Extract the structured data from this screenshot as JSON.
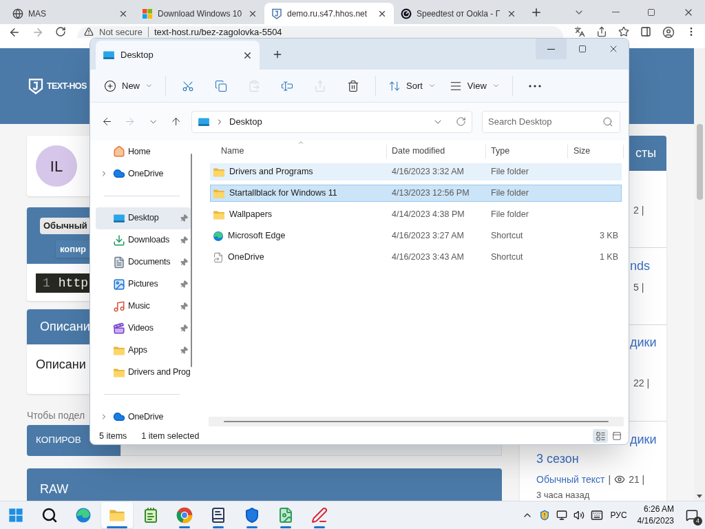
{
  "browser": {
    "tabs": [
      {
        "kind": "globe",
        "title": "MAS",
        "selected": false
      },
      {
        "kind": "squares",
        "title": "Download Windows 10",
        "selected": false
      },
      {
        "kind": "site",
        "title": "demo.ru.s47.hhos.net",
        "selected": true
      },
      {
        "kind": "gauge",
        "title": "Speedtest от Ookla - Г",
        "selected": false
      }
    ],
    "security": "Not secure",
    "url": "text-host.ru/bez-zagolovka-5504"
  },
  "page": {
    "logo": "TEXT-HOS",
    "avatar": "IL",
    "badge": "Обычный",
    "copy_link": "копир",
    "code_line": "1",
    "code_text": "http",
    "description_title": "Описани",
    "description_text": "Описани",
    "share_hint": "Чтобы подел",
    "copy_button": "КОПИРОВ",
    "raw_button": "RAW",
    "sidebar": {
      "title": "сты",
      "items": [
        {
          "meta": "2 |"
        },
        {
          "title": "nds",
          "meta": "5 |"
        },
        {
          "title": "дики",
          "meta": "22 |"
        }
      ],
      "last_item": {
        "title": "дики",
        "subtitle": "3 сезон",
        "category": "Обычный текст",
        "separator": "|",
        "views": "21 |",
        "time": "3 часа назад"
      }
    }
  },
  "explorer": {
    "tab": "Desktop",
    "toolbar": [
      [
        {
          "kind": "new",
          "label": "New",
          "disabled": false
        }
      ],
      [
        {
          "kind": "cut",
          "disabled": false
        },
        {
          "kind": "copy",
          "disabled": false
        },
        {
          "kind": "paste",
          "disabled": true
        },
        {
          "kind": "rename",
          "disabled": false
        },
        {
          "kind": "share",
          "disabled": true
        },
        {
          "kind": "delete",
          "disabled": false
        }
      ],
      [
        {
          "kind": "sort",
          "label": "Sort",
          "disabled": false
        },
        {
          "kind": "view",
          "label": "View",
          "disabled": false
        }
      ],
      [
        {
          "kind": "more",
          "disabled": false
        }
      ]
    ],
    "back_disabled": false,
    "forward_disabled": true,
    "path": "Desktop",
    "search_placeholder": "Search Desktop",
    "nav": [
      {
        "items": [
          {
            "kind": "home",
            "label": "Home",
            "expandable": false,
            "pinned": false,
            "selected": false
          },
          {
            "kind": "cloud",
            "label": "OneDrive",
            "expandable": true,
            "pinned": false,
            "selected": false
          }
        ]
      },
      {
        "items": [
          {
            "kind": "desktop",
            "label": "Desktop",
            "expandable": false,
            "pinned": true,
            "selected": true
          },
          {
            "kind": "download",
            "label": "Downloads",
            "expandable": false,
            "pinned": true,
            "selected": false
          },
          {
            "kind": "document",
            "label": "Documents",
            "expandable": false,
            "pinned": true,
            "selected": false
          },
          {
            "kind": "picture",
            "label": "Pictures",
            "expandable": false,
            "pinned": true,
            "selected": false
          },
          {
            "kind": "music",
            "label": "Music",
            "expandable": false,
            "pinned": true,
            "selected": false
          },
          {
            "kind": "video",
            "label": "Videos",
            "expandable": false,
            "pinned": true,
            "selected": false
          },
          {
            "kind": "apps",
            "label": "Apps",
            "expandable": false,
            "pinned": true,
            "selected": false
          },
          {
            "kind": "folder",
            "label": "Drivers and Prog",
            "expandable": false,
            "pinned": false,
            "selected": false
          }
        ]
      },
      {
        "items": [
          {
            "kind": "cloud",
            "label": "OneDrive",
            "expandable": true,
            "pinned": false,
            "selected": false
          }
        ]
      }
    ],
    "columns": [
      "Name",
      "Date modified",
      "Type",
      "Size"
    ],
    "files": [
      {
        "kind": "folder",
        "name": "Drivers and Programs",
        "date": "4/16/2023 3:32 AM",
        "type": "File folder",
        "hovered": true,
        "selected": false
      },
      {
        "kind": "folder",
        "name": "Startallblack for Windows 11",
        "date": "4/13/2023 12:56 PM",
        "type": "File folder",
        "hovered": false,
        "selected": true
      },
      {
        "kind": "folder",
        "name": "Wallpapers",
        "date": "4/14/2023 4:38 PM",
        "type": "File folder",
        "hovered": false,
        "selected": false
      },
      {
        "kind": "browser",
        "name": "Microsoft Edge",
        "date": "4/16/2023 3:27 AM",
        "type": "Shortcut",
        "size": "3 KB",
        "hovered": false,
        "selected": false
      },
      {
        "kind": "shortcut",
        "name": "OneDrive",
        "date": "4/16/2023 3:43 AM",
        "type": "Shortcut",
        "size": "1 KB",
        "hovered": false,
        "selected": false
      }
    ],
    "status_count": "5 items",
    "status_selection": "1 item selected",
    "views": [
      {
        "kind": "details",
        "selected": true
      },
      {
        "kind": "tiles",
        "selected": false
      }
    ]
  },
  "taskbar": {
    "apps": [
      {
        "kind": "start",
        "running": false,
        "selected": false
      },
      {
        "kind": "search",
        "running": false,
        "selected": false
      },
      {
        "kind": "edge",
        "running": false,
        "selected": false
      },
      {
        "kind": "explorer",
        "running": true,
        "selected": true
      },
      {
        "kind": "notepad",
        "running": false,
        "selected": false
      },
      {
        "kind": "chrome",
        "running": true,
        "selected": false
      },
      {
        "kind": "reader",
        "running": true,
        "selected": false
      },
      {
        "kind": "shield",
        "running": true,
        "selected": false
      },
      {
        "kind": "image",
        "running": true,
        "selected": false
      },
      {
        "kind": "pen",
        "running": true,
        "selected": false
      }
    ],
    "language": "РУС",
    "time": "6:26 AM",
    "date": "4/16/2023",
    "notifications": "4"
  }
}
